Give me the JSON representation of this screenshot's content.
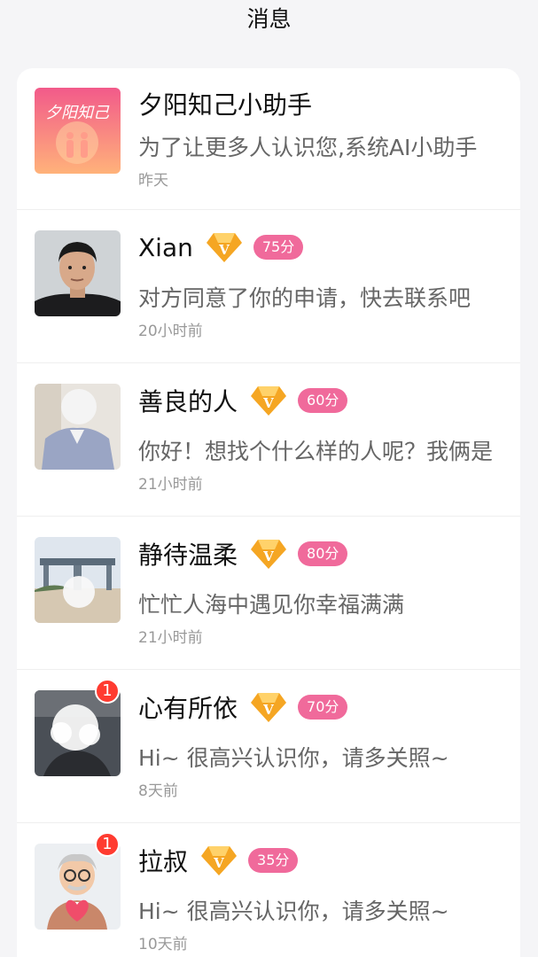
{
  "header": {
    "title": "消息"
  },
  "colors": {
    "score_pill": "#f06a9b",
    "badge": "#ff3b30",
    "vip_gold": "#f5a623"
  },
  "conversations": [
    {
      "name": "夕阳知己小助手",
      "message": "为了让更多人认识您,系统AI小助手",
      "time": "昨天",
      "avatar_text": "夕阳知己",
      "avatar_type": "brand-logo"
    },
    {
      "name": "Xian",
      "vip": true,
      "score": "75分",
      "message": "对方同意了你的申请，快去联系吧",
      "time": "20小时前",
      "avatar_type": "man-portrait"
    },
    {
      "name": "善良的人",
      "vip": true,
      "score": "60分",
      "message": "你好！想找个什么样的人呢？我俩是",
      "time": "21小时前",
      "avatar_type": "blurred-photo"
    },
    {
      "name": "静待温柔",
      "vip": true,
      "score": "80分",
      "message": "忙忙人海中遇见你幸福满满",
      "time": "21小时前",
      "avatar_type": "blurred-photo"
    },
    {
      "name": "心有所依",
      "vip": true,
      "score": "70分",
      "message": "Hi~ 很高兴认识你，请多关照~",
      "time": "8天前",
      "unread": "1",
      "avatar_type": "blurred-photo"
    },
    {
      "name": "拉叔",
      "vip": true,
      "score": "35分",
      "message": "Hi~ 很高兴认识你，请多关照~",
      "time": "10天前",
      "unread": "1",
      "avatar_type": "cartoon-grandpa"
    }
  ]
}
